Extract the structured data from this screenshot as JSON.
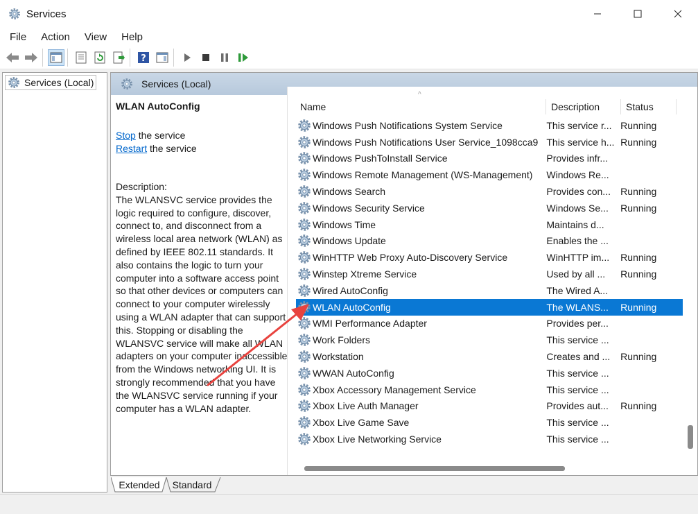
{
  "window": {
    "title": "Services"
  },
  "menu": {
    "file": "File",
    "action": "Action",
    "view": "View",
    "help": "Help"
  },
  "tree": {
    "root_label": "Services (Local)"
  },
  "panel": {
    "header": "Services (Local)"
  },
  "details": {
    "service_name": "WLAN AutoConfig",
    "stop_link": "Stop",
    "stop_rest": " the service",
    "restart_link": "Restart",
    "restart_rest": " the service",
    "description_label": "Description:",
    "description_text": "The WLANSVC service provides the logic required to configure, discover, connect to, and disconnect from a wireless local area network (WLAN) as defined by IEEE 802.11 standards. It also contains the logic to turn your computer into a software access point so that other devices or computers can connect to your computer wirelessly using a WLAN adapter that can support this. Stopping or disabling the WLANSVC service will make all WLAN adapters on your computer inaccessible from the Windows networking UI. It is strongly recommended that you have the WLANSVC service running if your computer has a WLAN adapter."
  },
  "columns": {
    "name": "Name",
    "description": "Description",
    "status": "Status"
  },
  "rows": [
    {
      "name": "Windows Push Notifications System Service",
      "description": "This service r...",
      "status": "Running"
    },
    {
      "name": "Windows Push Notifications User Service_1098cca9",
      "description": "This service h...",
      "status": "Running"
    },
    {
      "name": "Windows PushToInstall Service",
      "description": "Provides infr...",
      "status": ""
    },
    {
      "name": "Windows Remote Management (WS-Management)",
      "description": "Windows Re...",
      "status": ""
    },
    {
      "name": "Windows Search",
      "description": "Provides con...",
      "status": "Running"
    },
    {
      "name": "Windows Security Service",
      "description": "Windows Se...",
      "status": "Running"
    },
    {
      "name": "Windows Time",
      "description": "Maintains d...",
      "status": ""
    },
    {
      "name": "Windows Update",
      "description": "Enables the ...",
      "status": ""
    },
    {
      "name": "WinHTTP Web Proxy Auto-Discovery Service",
      "description": "WinHTTP im...",
      "status": "Running"
    },
    {
      "name": "Winstep Xtreme Service",
      "description": "Used by all ...",
      "status": "Running"
    },
    {
      "name": "Wired AutoConfig",
      "description": "The Wired A...",
      "status": ""
    },
    {
      "name": "WLAN AutoConfig",
      "description": "The WLANS...",
      "status": "Running",
      "selected": true
    },
    {
      "name": "WMI Performance Adapter",
      "description": "Provides per...",
      "status": ""
    },
    {
      "name": "Work Folders",
      "description": "This service ...",
      "status": ""
    },
    {
      "name": "Workstation",
      "description": "Creates and ...",
      "status": "Running"
    },
    {
      "name": "WWAN AutoConfig",
      "description": "This service ...",
      "status": ""
    },
    {
      "name": "Xbox Accessory Management Service",
      "description": "This service ...",
      "status": ""
    },
    {
      "name": "Xbox Live Auth Manager",
      "description": "Provides aut...",
      "status": "Running"
    },
    {
      "name": "Xbox Live Game Save",
      "description": "This service ...",
      "status": ""
    },
    {
      "name": "Xbox Live Networking Service",
      "description": "This service ...",
      "status": ""
    }
  ],
  "tabs": {
    "extended": "Extended",
    "standard": "Standard"
  },
  "colors": {
    "selection": "#0a78d4",
    "link": "#0066cc",
    "annotation_arrow": "#e8433f"
  }
}
